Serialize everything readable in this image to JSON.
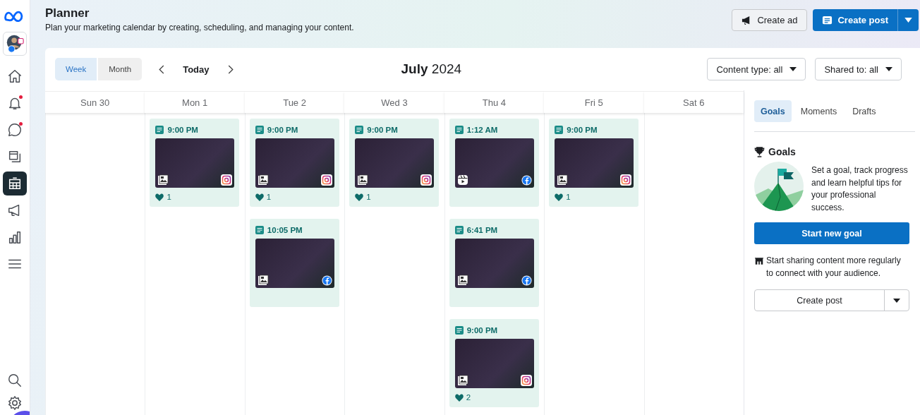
{
  "header": {
    "title": "Planner",
    "subtitle": "Plan your marketing calendar by creating, scheduling, and managing your content.",
    "buttons": [
      {
        "kind": "secondary",
        "label": "Create ad"
      },
      {
        "kind": "primary",
        "label": "Create post"
      }
    ]
  },
  "sidebar": {
    "items": [
      {
        "kind": "home",
        "selected": false,
        "notification": false
      },
      {
        "kind": "notifications",
        "selected": false,
        "notification": true
      },
      {
        "kind": "messages",
        "selected": false,
        "notification": true
      },
      {
        "kind": "content",
        "selected": false,
        "notification": false
      },
      {
        "kind": "planner",
        "selected": true,
        "notification": false
      },
      {
        "kind": "ads",
        "selected": false,
        "notification": false
      },
      {
        "kind": "insights",
        "selected": false,
        "notification": false
      },
      {
        "kind": "menu",
        "selected": false,
        "notification": false
      }
    ],
    "bottom_items": [
      {
        "kind": "search"
      },
      {
        "kind": "settings"
      }
    ]
  },
  "toolbar": {
    "views": [
      {
        "label": "Week",
        "selected": true
      },
      {
        "label": "Month",
        "selected": false
      }
    ],
    "today": "Today",
    "period": "**July** 2024",
    "filters": [
      "Content type: all",
      "Shared to: all"
    ]
  },
  "calendar": {
    "days": [
      {
        "label": "Sun 30"
      },
      {
        "label": "Mon 1",
        "posts": [
          {
            "time": "9:00 PM",
            "icons": [
              {
                "kind": "photo"
              },
              {
                "kind": "instagram"
              }
            ],
            "likes": "1"
          }
        ]
      },
      {
        "label": "Tue 2",
        "posts": [
          {
            "time": "9:00 PM",
            "icons": [
              {
                "kind": "photo"
              },
              {
                "kind": "instagram"
              }
            ],
            "likes": "1"
          },
          {
            "time": "10:05 PM",
            "icons": [
              {
                "kind": "photo"
              },
              {
                "kind": "facebook"
              }
            ]
          }
        ]
      },
      {
        "label": "Wed 3",
        "posts": [
          {
            "time": "9:00 PM",
            "icons": [
              {
                "kind": "photo"
              },
              {
                "kind": "instagram"
              }
            ],
            "likes": "1"
          }
        ]
      },
      {
        "label": "Thu 4",
        "posts": [
          {
            "time": "1:12 AM",
            "icons": [
              {
                "kind": "reel"
              },
              {
                "kind": "facebook"
              }
            ]
          },
          {
            "time": "6:41 PM",
            "icons": [
              {
                "kind": "photo"
              },
              {
                "kind": "facebook"
              }
            ]
          },
          {
            "time": "9:00 PM",
            "icons": [
              {
                "kind": "photo"
              },
              {
                "kind": "instagram"
              }
            ],
            "likes": "2"
          }
        ]
      },
      {
        "label": "Fri 5",
        "posts": [
          {
            "time": "9:00 PM",
            "icons": [
              {
                "kind": "photo"
              },
              {
                "kind": "instagram"
              }
            ],
            "likes": "1"
          }
        ]
      },
      {
        "label": "Sat 6"
      }
    ]
  },
  "panel": {
    "tabs": [
      {
        "label": "Goals",
        "selected": true
      },
      {
        "label": "Moments",
        "selected": false
      },
      {
        "label": "Drafts",
        "selected": false
      }
    ],
    "goals": {
      "title": "Goals",
      "text": "Set a goal, track progress and learn helpful tips for your professional success.",
      "button": "Start new goal"
    },
    "tip": "Start sharing content more regularly to connect with your audience.",
    "create_button": "Create post"
  }
}
